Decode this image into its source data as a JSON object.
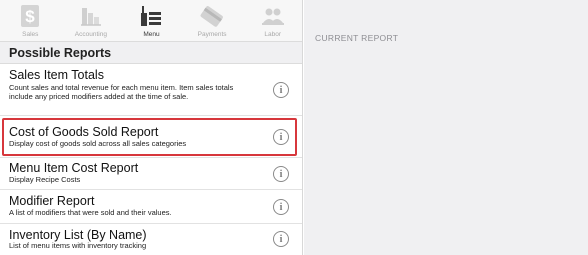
{
  "tabs": [
    {
      "label": "Sales",
      "icon": "dollar-icon",
      "active": false
    },
    {
      "label": "Accounting",
      "icon": "chart-icon",
      "active": false
    },
    {
      "label": "Menu",
      "icon": "menu-glass-icon",
      "active": true
    },
    {
      "label": "Payments",
      "icon": "card-icon",
      "active": false
    },
    {
      "label": "Labor",
      "icon": "people-icon",
      "active": false
    }
  ],
  "section_header": "Possible Reports",
  "reports": [
    {
      "title": "Sales Item Totals",
      "description": "Count sales and total revenue for each menu item. Item sales totals include any priced modifiers added at the time of sale."
    },
    {
      "title": "Cost of Goods Sold Report",
      "description": "Display cost of goods sold across all sales categories",
      "highlighted": true
    },
    {
      "title": "Menu Item Cost Report",
      "description": "Display Recipe Costs"
    },
    {
      "title": "Modifier Report",
      "description": "A list of modifiers that were sold and their values."
    },
    {
      "title": "Inventory List (By Name)",
      "description": "List of menu items with inventory tracking"
    }
  ],
  "right_panel": {
    "title": "CURRENT REPORT"
  },
  "info_glyph": "i",
  "colors": {
    "highlight": "#d7373c",
    "panel_bg": "#f0f0f2"
  }
}
